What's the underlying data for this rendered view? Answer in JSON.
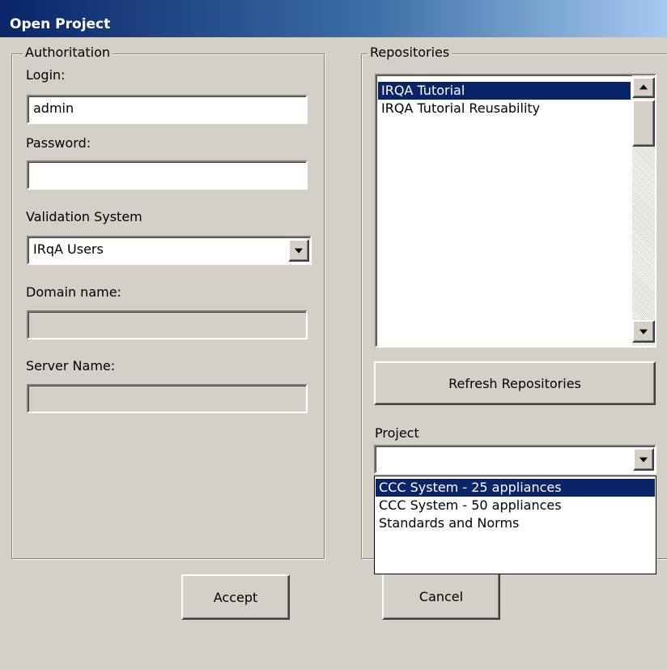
{
  "window": {
    "title": "Open Project"
  },
  "authorization": {
    "group_label": "Authoritation",
    "login_label": "Login:",
    "login_value": "admin",
    "password_label": "Password:",
    "password_value": "",
    "validation_label": "Validation System",
    "validation_value": "IRqA Users",
    "domain_label": "Domain name:",
    "domain_value": "",
    "server_label": "Server Name:",
    "server_value": ""
  },
  "repositories": {
    "group_label": "Repositories",
    "items": [
      {
        "label": "IRQA Tutorial",
        "selected": true
      },
      {
        "label": "IRQA Tutorial Reusability",
        "selected": false
      }
    ],
    "refresh_label": "Refresh Repositories"
  },
  "project": {
    "label": "Project",
    "value": "",
    "options": [
      {
        "label": "CCC System - 25 appliances",
        "selected": true
      },
      {
        "label": "CCC System - 50 appliances",
        "selected": false
      },
      {
        "label": "Standards and Norms",
        "selected": false
      }
    ]
  },
  "buttons": {
    "accept": "Accept",
    "cancel": "Cancel"
  },
  "colors": {
    "face": "#d4d0c8",
    "selection": "#0a246a",
    "title_start": "#0a246a",
    "title_end": "#a6caf0"
  }
}
